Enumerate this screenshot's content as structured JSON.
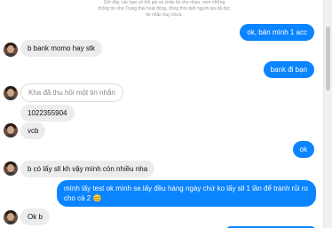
{
  "notice": "Giờ đây, các bạn có thể gọi và nhắn tin cho nhau, xem những thông tin như Trạng thái hoạt động, đồng thời biết người kia đã đọc tin nhắn hay chưa.",
  "messages": [
    {
      "from": "me",
      "text": "ok, bán mình 1 acc"
    },
    {
      "from": "them",
      "text": "b bank momo hay stk"
    },
    {
      "from": "me",
      "text": "bank đi bạn"
    },
    {
      "from": "them",
      "text": "Kha đã thu hồi một tin nhắn"
    },
    {
      "from": "them",
      "text": "1022355904"
    },
    {
      "from": "them",
      "text": "vcb"
    },
    {
      "from": "me",
      "text": "ok"
    },
    {
      "from": "them",
      "text": "b có lấy sll kh vậy mình còn nhiều nha"
    },
    {
      "from": "me",
      "text": "mình lấy test ok mình se.lấy đều hàng ngày chứ ko lấy sll 1 lần để tránh rủi ro cho cả 2 😊"
    },
    {
      "from": "them",
      "text": "Ok b"
    }
  ],
  "colors": {
    "outgoing": "#0b84ff",
    "incoming": "#ececec",
    "background": "#ffffff"
  },
  "icons": {
    "reply": "reply-icon",
    "avatar": "avatar"
  }
}
